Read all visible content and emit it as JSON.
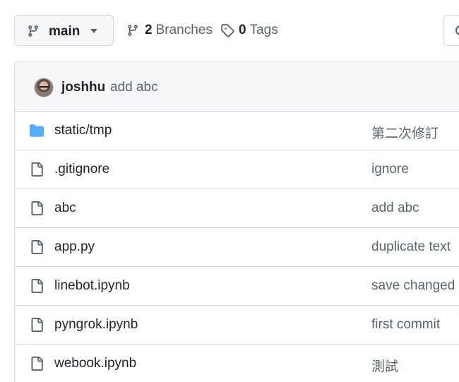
{
  "branch_selector": {
    "label": "main",
    "icon": "git-branch-icon",
    "caret": "triangle-down-icon"
  },
  "branches": {
    "count": "2",
    "label": "Branches",
    "icon": "git-branch-icon"
  },
  "tags": {
    "count": "0",
    "label": "Tags",
    "icon": "tag-icon"
  },
  "latest_commit": {
    "author": "joshhu",
    "message": "add abc"
  },
  "files": [
    {
      "name": "static/tmp",
      "type": "directory",
      "icon": "folder-icon",
      "message": "第二次修訂"
    },
    {
      "name": ".gitignore",
      "type": "file",
      "icon": "file-icon",
      "message": "ignore"
    },
    {
      "name": "abc",
      "type": "file",
      "icon": "file-icon",
      "message": "add abc"
    },
    {
      "name": "app.py",
      "type": "file",
      "icon": "file-icon",
      "message": "duplicate text"
    },
    {
      "name": "linebot.ipynb",
      "type": "file",
      "icon": "file-icon",
      "message": "save changed"
    },
    {
      "name": "pyngrok.ipynb",
      "type": "file",
      "icon": "file-icon",
      "message": "first commit"
    },
    {
      "name": "webook.ipynb",
      "type": "file",
      "icon": "file-icon",
      "message": "測試"
    }
  ],
  "colors": {
    "folder": "#54aeff",
    "muted": "#59636e",
    "border": "#d1d9e0",
    "fg": "#1f2328"
  }
}
